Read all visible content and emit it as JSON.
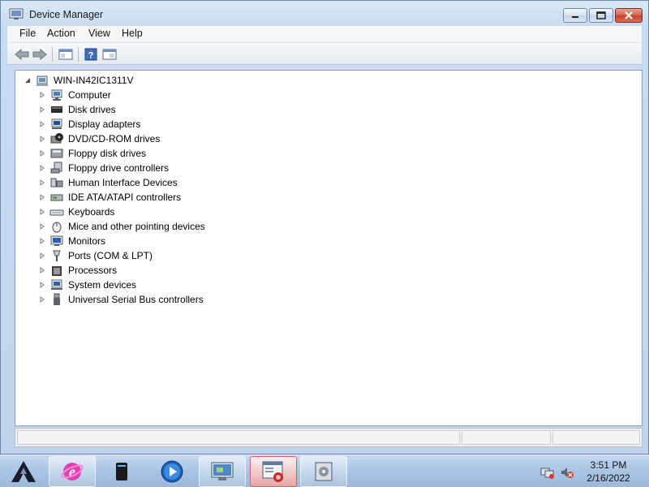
{
  "window": {
    "title": "Device Manager"
  },
  "menu": [
    "File",
    "Action",
    "View",
    "Help"
  ],
  "tree": {
    "root": "WIN-IN42IC1311V",
    "items": [
      {
        "label": "Computer",
        "icon": "computer-icon"
      },
      {
        "label": "Disk drives",
        "icon": "disk-drive-icon"
      },
      {
        "label": "Display adapters",
        "icon": "display-adapter-icon"
      },
      {
        "label": "DVD/CD-ROM drives",
        "icon": "dvd-drive-icon"
      },
      {
        "label": "Floppy disk drives",
        "icon": "floppy-disk-icon"
      },
      {
        "label": "Floppy drive controllers",
        "icon": "floppy-controller-icon"
      },
      {
        "label": "Human Interface Devices",
        "icon": "hid-icon"
      },
      {
        "label": "IDE ATA/ATAPI controllers",
        "icon": "ide-controller-icon"
      },
      {
        "label": "Keyboards",
        "icon": "keyboard-icon"
      },
      {
        "label": "Mice and other pointing devices",
        "icon": "mouse-icon"
      },
      {
        "label": "Monitors",
        "icon": "monitor-icon"
      },
      {
        "label": "Ports (COM & LPT)",
        "icon": "port-icon"
      },
      {
        "label": "Processors",
        "icon": "processor-icon"
      },
      {
        "label": "System devices",
        "icon": "system-device-icon"
      },
      {
        "label": "Universal Serial Bus controllers",
        "icon": "usb-icon"
      }
    ]
  },
  "taskbar": {
    "apps": [
      "start-icon",
      "internet-explorer-icon",
      "drive-icon",
      "media-player-icon",
      "control-panel-icon",
      "device-manager-icon",
      "disk-utility-icon"
    ],
    "clock": {
      "time": "3:51 PM",
      "date": "2/16/2022"
    }
  },
  "colors": {
    "frame": "#c9dcf1",
    "close_button": "#c6402a",
    "taskbar": "#a9c4e4"
  }
}
